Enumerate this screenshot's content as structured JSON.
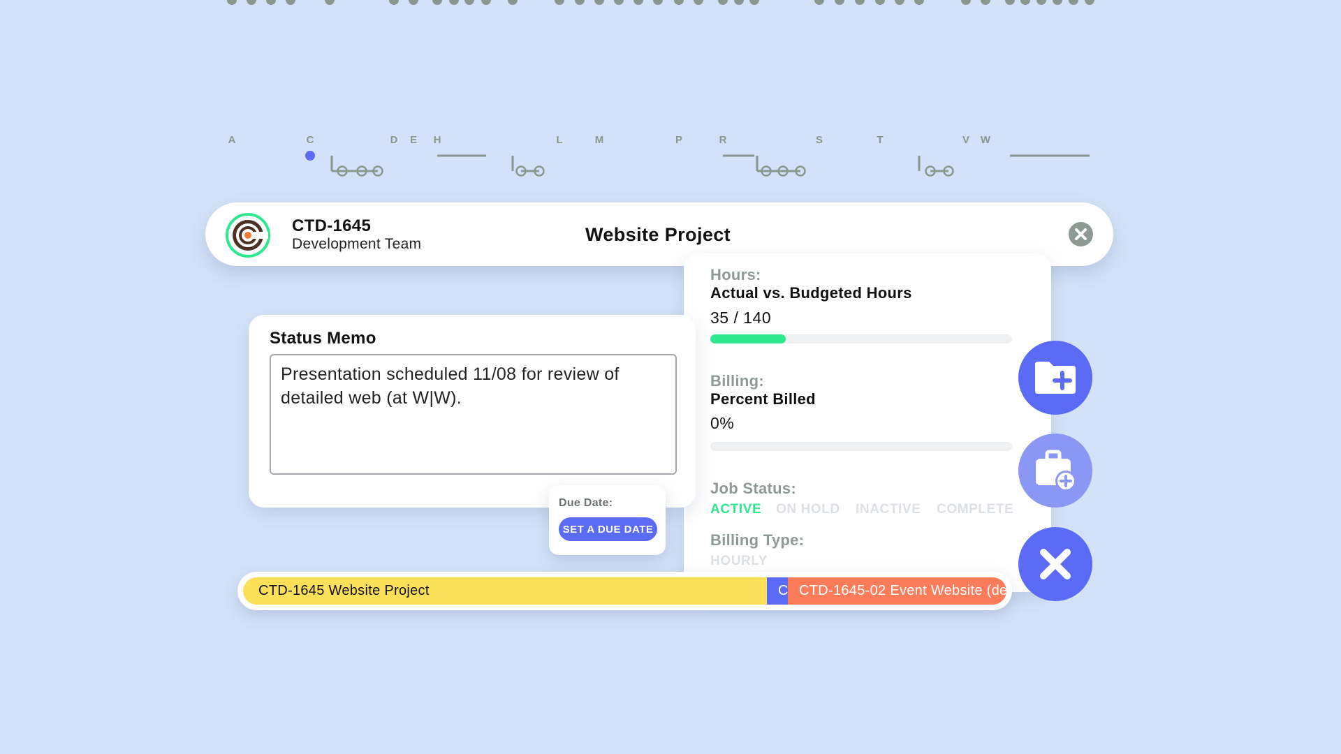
{
  "timeline": {
    "letters": [
      "A",
      "C",
      "D",
      "E",
      "H",
      "L",
      "M",
      "P",
      "R",
      "S",
      "T",
      "V",
      "W"
    ],
    "colors": {
      "dot": "#8a9790",
      "active": "#5b6bf5"
    }
  },
  "header": {
    "job_code": "CTD-1645",
    "team": "Development Team",
    "project_title": "Website Project"
  },
  "status_memo": {
    "title": "Status Memo",
    "text": "Presentation scheduled 11/08 for review of detailed web (at W|W)."
  },
  "due_date": {
    "label": "Due Date:",
    "button_label": "SET A DUE DATE"
  },
  "hours": {
    "label": "Hours:",
    "subtitle": "Actual vs. Budgeted Hours",
    "value_text": "35 / 140",
    "progress": 0.25
  },
  "billing": {
    "label": "Billing:",
    "subtitle": "Percent Billed",
    "value_text": "0%",
    "progress": 0
  },
  "job_status": {
    "label": "Job Status:",
    "options": [
      "ACTIVE",
      "ON HOLD",
      "INACTIVE",
      "COMPLETE"
    ],
    "selected": "ACTIVE"
  },
  "billing_type": {
    "label": "Billing Type:",
    "value": "HOURLY"
  },
  "gantt": {
    "segments": [
      {
        "label": "CTD-1645 Website Project",
        "color": "#fde05a"
      },
      {
        "label": "C",
        "color": "#5b6bf5"
      },
      {
        "label": "CTD-1645-02  Event Website (de",
        "color": "#fb7c5a"
      }
    ]
  },
  "actions": {
    "icons": [
      "folder-plus-icon",
      "briefcase-plus-icon",
      "close-icon"
    ]
  },
  "colors": {
    "background": "#d3e2f8",
    "accent": "#5b6bf5",
    "success": "#2ee88f",
    "muted": "#8f9a94"
  }
}
